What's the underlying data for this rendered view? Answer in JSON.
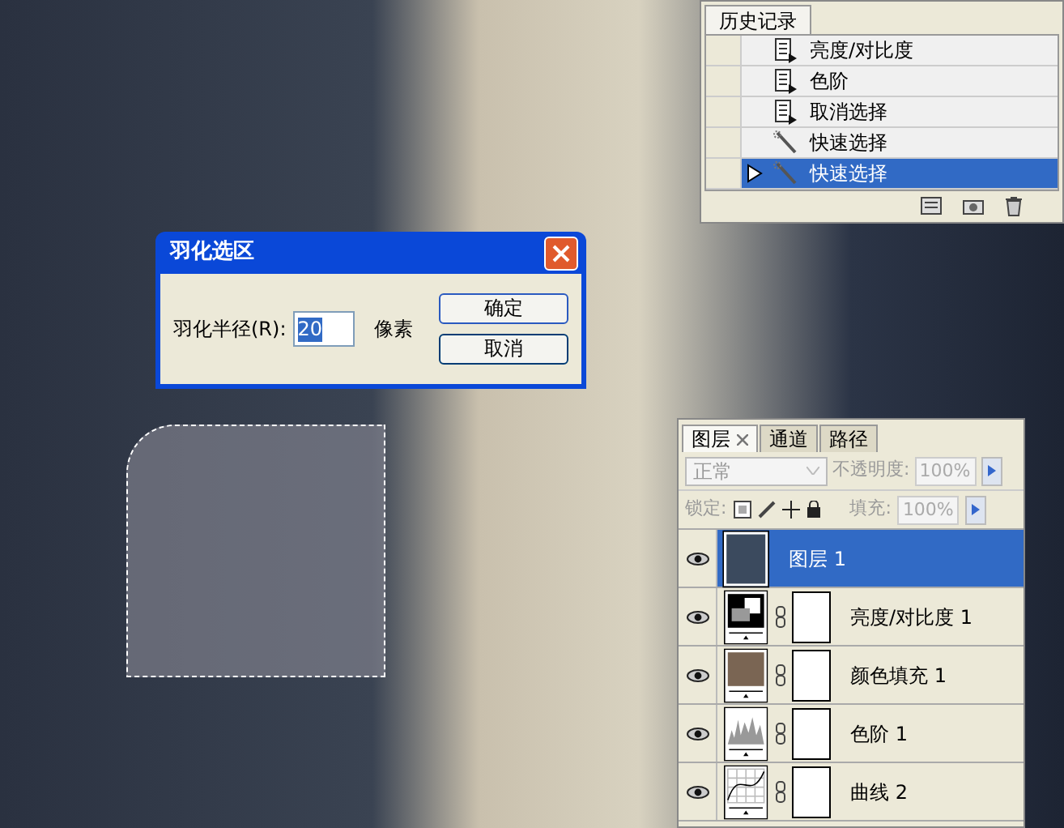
{
  "history": {
    "tab": "历史记录",
    "items": [
      {
        "label": "亮度/对比度",
        "kind": "adjust",
        "selected": false
      },
      {
        "label": "色阶",
        "kind": "adjust",
        "selected": false
      },
      {
        "label": "取消选择",
        "kind": "adjust",
        "selected": false
      },
      {
        "label": "快速选择",
        "kind": "quick-select",
        "selected": false
      },
      {
        "label": "快速选择",
        "kind": "quick-select",
        "selected": true
      }
    ]
  },
  "dialog": {
    "title": "羽化选区",
    "field_label": "羽化半径(R):",
    "value": "20",
    "unit": "像素",
    "buttons": [
      "确定",
      "取消"
    ]
  },
  "layers_panel": {
    "tabs": [
      {
        "label": "图层",
        "selected": true
      },
      {
        "label": "通道",
        "selected": false
      },
      {
        "label": "路径",
        "selected": false
      }
    ],
    "blend_mode": "正常",
    "opacity_label": "不透明度:",
    "opacity": "100%",
    "lock_label": "锁定:",
    "fill_label": "填充:",
    "fill": "100%",
    "layers": [
      {
        "name": "图层 1",
        "kind": "pixel",
        "selected": true,
        "visible": true
      },
      {
        "name": "亮度/对比度 1",
        "kind": "brightness",
        "selected": false,
        "visible": true
      },
      {
        "name": "颜色填充 1",
        "kind": "fill",
        "selected": false,
        "visible": true
      },
      {
        "name": "色阶 1",
        "kind": "levels",
        "selected": false,
        "visible": true
      },
      {
        "name": "曲线 2",
        "kind": "curves",
        "selected": false,
        "visible": true
      }
    ]
  }
}
